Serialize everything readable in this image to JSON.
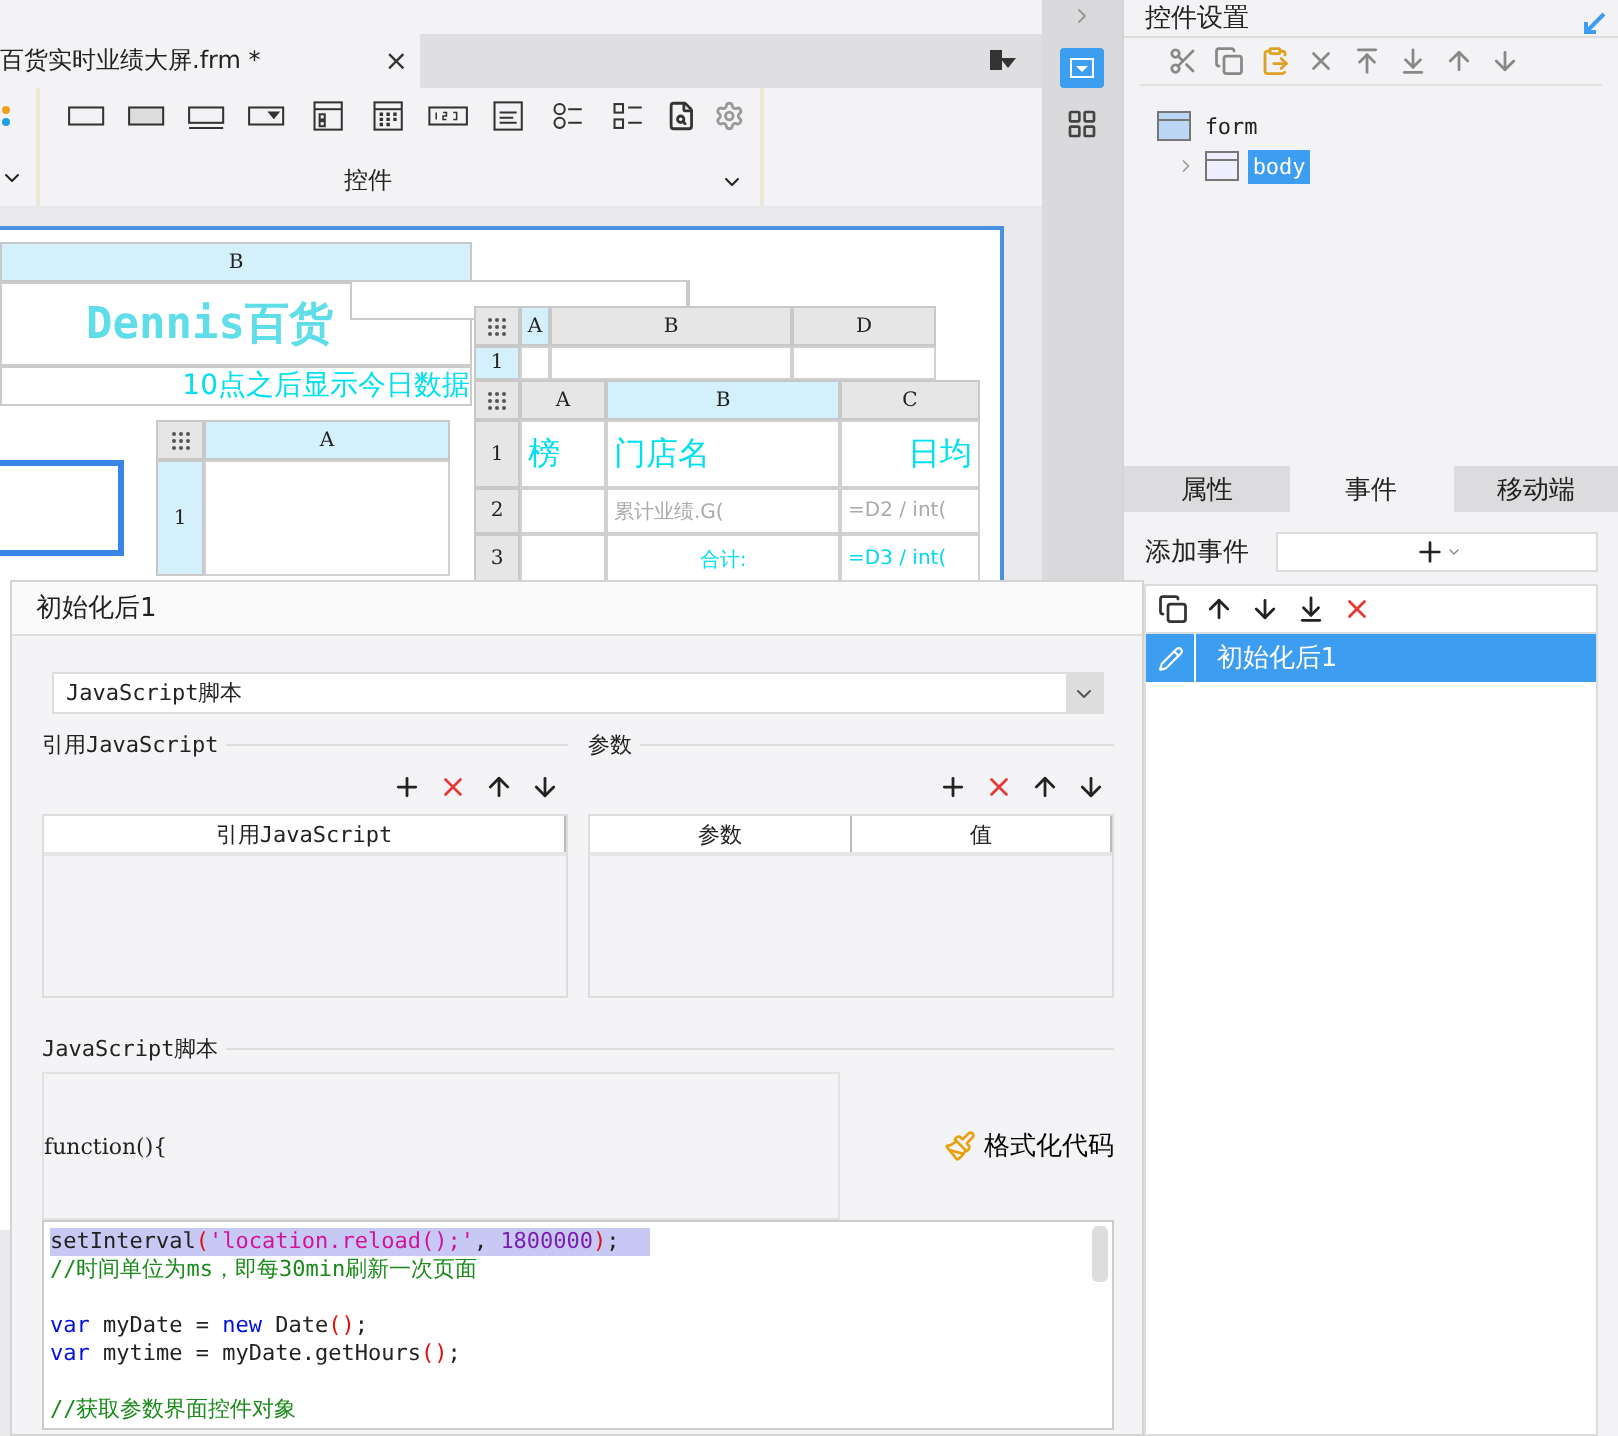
{
  "tab": {
    "title": "百货实时业绩大屏.frm *",
    "close": "×"
  },
  "toolbar": {
    "group_label": "控件"
  },
  "canvas": {
    "header": "B",
    "title": "Dennis百货",
    "subtitle": "10点之后显示今日数据",
    "grid_top": {
      "columns": [
        "A",
        "B",
        "D"
      ],
      "rows": [
        "1"
      ]
    },
    "grid_main": {
      "columns": [
        "A",
        "B",
        "C"
      ],
      "rows": [
        {
          "number": "1",
          "cells": [
            {
              "text": "榜",
              "kind": "label"
            },
            {
              "text": "门店名",
              "kind": "label"
            },
            {
              "text": "日均",
              "kind": "label-right"
            }
          ]
        },
        {
          "number": "2",
          "cells": [
            {
              "kind": "blank"
            },
            {
              "text": "累计业绩.G(",
              "kind": "formula"
            },
            {
              "text": "=D2 / int(",
              "kind": "formula"
            }
          ]
        },
        {
          "number": "3",
          "cells": [
            {
              "kind": "blank"
            },
            {
              "text": "合计:",
              "kind": "label-center"
            },
            {
              "text": "=D3 / int(",
              "kind": "formula-cyan"
            }
          ]
        }
      ]
    },
    "grid_left": {
      "columns": [
        "A"
      ],
      "rows": [
        "1"
      ]
    }
  },
  "side_panel": {
    "title": "控件设置",
    "tree": [
      {
        "label": "form",
        "selected": false,
        "children": [
          {
            "label": "body",
            "selected": true
          }
        ]
      }
    ]
  },
  "property_tabs": [
    {
      "label": "属性",
      "selected": false
    },
    {
      "label": "事件",
      "selected": true
    },
    {
      "label": "移动端",
      "selected": false
    }
  ],
  "add_event": {
    "label": "添加事件"
  },
  "events": [
    {
      "label": "初始化后1",
      "selected": true
    }
  ],
  "dialog": {
    "title": "初始化后1",
    "script_type": "JavaScript脚本",
    "ref_section": "引用JavaScript",
    "ref_columns": [
      "引用JavaScript"
    ],
    "param_section": "参数",
    "param_columns": [
      "参数",
      "值"
    ],
    "script_section": "JavaScript脚本",
    "function_header": "function(){",
    "format_button": "格式化代码",
    "code": [
      {
        "highlighted": true,
        "tokens": [
          {
            "kind": "plain",
            "text": "setInterval"
          },
          {
            "kind": "paren",
            "text": "("
          },
          {
            "kind": "string",
            "text": "'location.reload();'"
          },
          {
            "kind": "plain",
            "text": ", "
          },
          {
            "kind": "number",
            "text": "1800000"
          },
          {
            "kind": "paren",
            "text": ")"
          },
          {
            "kind": "plain",
            "text": ";"
          }
        ]
      },
      {
        "highlighted": false,
        "tokens": [
          {
            "kind": "comment",
            "text": "//时间单位为ms，即每30min刷新一次页面"
          }
        ]
      },
      {
        "highlighted": false
      },
      {
        "highlighted": false,
        "tokens": [
          {
            "kind": "keyword",
            "text": "var"
          },
          {
            "kind": "plain",
            "text": " myDate = "
          },
          {
            "kind": "keyword",
            "text": "new"
          },
          {
            "kind": "plain",
            "text": " Date"
          },
          {
            "kind": "paren",
            "text": "()"
          },
          {
            "kind": "plain",
            "text": ";"
          }
        ]
      },
      {
        "highlighted": false,
        "tokens": [
          {
            "kind": "keyword",
            "text": "var"
          },
          {
            "kind": "plain",
            "text": " mytime = myDate.getHours"
          },
          {
            "kind": "paren",
            "text": "()"
          },
          {
            "kind": "plain",
            "text": ";"
          }
        ]
      },
      {
        "highlighted": false
      },
      {
        "highlighted": false,
        "tokens": [
          {
            "kind": "comment",
            "text": "//获取参数界面控件对象"
          }
        ]
      }
    ]
  }
}
